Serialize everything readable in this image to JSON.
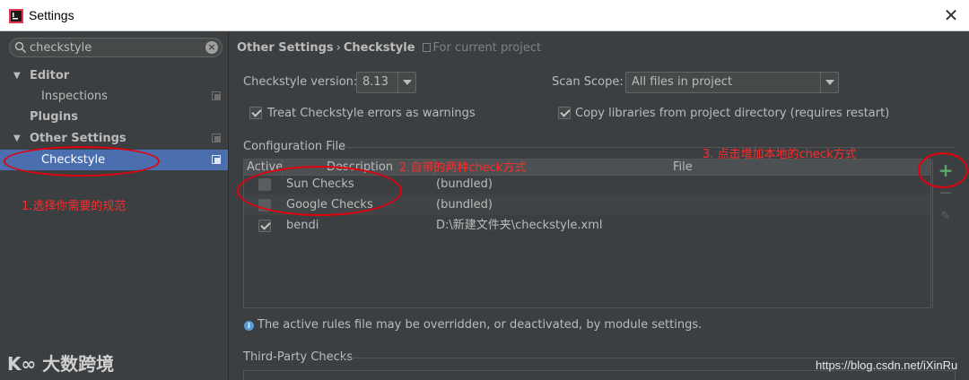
{
  "window": {
    "title": "Settings",
    "close_glyph": "✕",
    "app_icon": "intellij-icon"
  },
  "sidebar": {
    "search": {
      "value": "checkstyle",
      "placeholder": "",
      "clear_glyph": "×"
    },
    "items": [
      {
        "label": "Editor",
        "arrow": "▼"
      },
      {
        "label": "Inspections"
      },
      {
        "label": "Plugins"
      },
      {
        "label": "Other Settings",
        "arrow": "▼"
      },
      {
        "label": "Checkstyle"
      }
    ],
    "annotation": "1.选择你需要的规范"
  },
  "breadcrumb": {
    "root": "Other Settings",
    "separator": "›",
    "current": "Checkstyle",
    "scope_note": "For current project"
  },
  "form": {
    "version_label": "Checkstyle version:",
    "version_value": "8.13",
    "scan_scope_label": "Scan Scope:",
    "scan_scope_value": "All files in project",
    "treat_errors_label": "Treat Checkstyle errors as warnings",
    "treat_errors_checked": true,
    "copy_libs_label": "Copy libraries from project directory (requires restart)",
    "copy_libs_checked": true
  },
  "config": {
    "group_title": "Configuration File",
    "columns": [
      "Active",
      "Description",
      "File"
    ],
    "rows": [
      {
        "active": false,
        "description": "Sun Checks",
        "file": "(bundled)"
      },
      {
        "active": false,
        "description": "Google Checks",
        "file": "(bundled)"
      },
      {
        "active": true,
        "description": "bendi",
        "file": "D:\\新建文件夹\\checkstyle.xml"
      }
    ],
    "tools": {
      "add": "+",
      "remove": "−",
      "edit": "✎"
    },
    "annotation_builtin": "2.自带的两种check方式",
    "annotation_add": "3.      点击增加本地的check方式"
  },
  "info_text": "The active rules file may be overridden, or deactivated, by module settings.",
  "third_party": {
    "group_title": "Third-Party Checks"
  },
  "watermarks": {
    "logo_text": "大数跨境",
    "logo_mark": "K∞",
    "url": "https://blog.csdn.net/iXinRu"
  },
  "colors": {
    "accent": "#4b6eaf",
    "annotation": "#ff2a2a",
    "add": "#59a869"
  }
}
